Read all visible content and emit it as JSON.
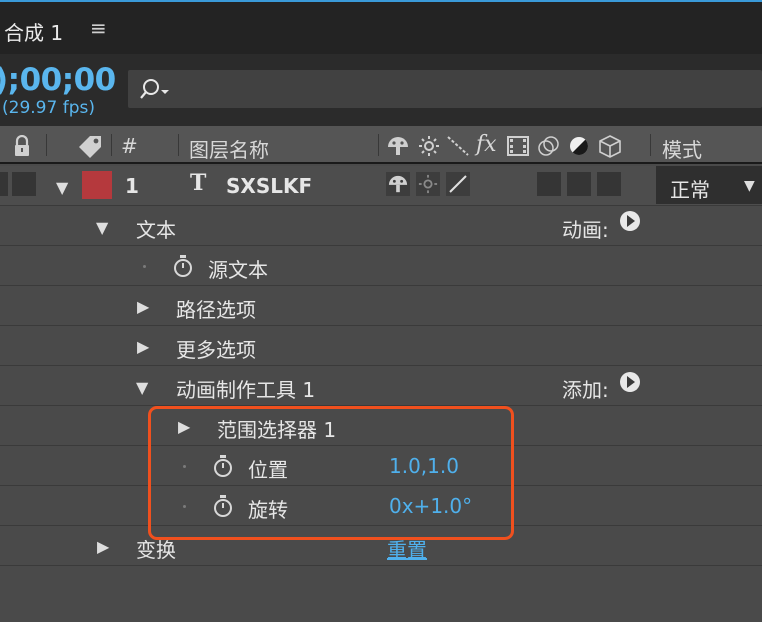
{
  "tab": {
    "title": "合成 1",
    "menu_glyph": "≡"
  },
  "time": {
    "timecode": ");00;00",
    "fps": "(29.97 fps)"
  },
  "search": {
    "placeholder": ""
  },
  "columns": {
    "hash": "#",
    "layer_name": "图层名称",
    "mode": "模式"
  },
  "layer": {
    "index": "1",
    "type_glyph": "T",
    "name": "SXSLKF",
    "label_color": "#b5393d",
    "mode_value": "正常"
  },
  "properties": {
    "text_group": "文本",
    "animate_label": "动画:",
    "source_text": "源文本",
    "path_options": "路径选项",
    "more_options": "更多选项",
    "animator": "动画制作工具 1",
    "add_label": "添加:",
    "range_selector": "范围选择器 1",
    "position_label": "位置",
    "position_value": "1.0,1.0",
    "rotation_label": "旋转",
    "rotation_value": "0x+1.0°",
    "transform": "变换",
    "reset": "重置"
  },
  "colors": {
    "accent_blue": "#4fb0ec",
    "highlight_orange": "#f0501e"
  }
}
